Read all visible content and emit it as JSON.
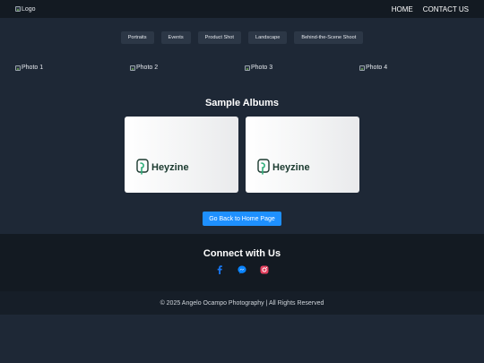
{
  "nav": {
    "logo_alt": "Logo",
    "links": [
      "HOME",
      "CONTACT US"
    ]
  },
  "filters": [
    "Portraits",
    "Events",
    "Product Shot",
    "Landscape",
    "Behind-the-Scene Shoot"
  ],
  "photos": [
    "Photo 1",
    "Photo 2",
    "Photo 3",
    "Photo 4"
  ],
  "albums": {
    "title": "Sample Albums",
    "cards": [
      {
        "brand": "Heyzine"
      },
      {
        "brand": "Heyzine"
      }
    ]
  },
  "home_button": "Go Back to Home Page",
  "footer": {
    "connect_title": "Connect with Us",
    "socials": [
      "facebook-icon",
      "messenger-icon",
      "instagram-icon"
    ],
    "copyright": "© 2025 Angelo Ocampo Photography | All Rights Reserved"
  },
  "colors": {
    "background": "#1e2836",
    "navbar": "#131a22",
    "accent": "#1e90ff",
    "facebook": "#1877f2",
    "messenger": "#0a84ff",
    "instagram": "#e4405f"
  }
}
